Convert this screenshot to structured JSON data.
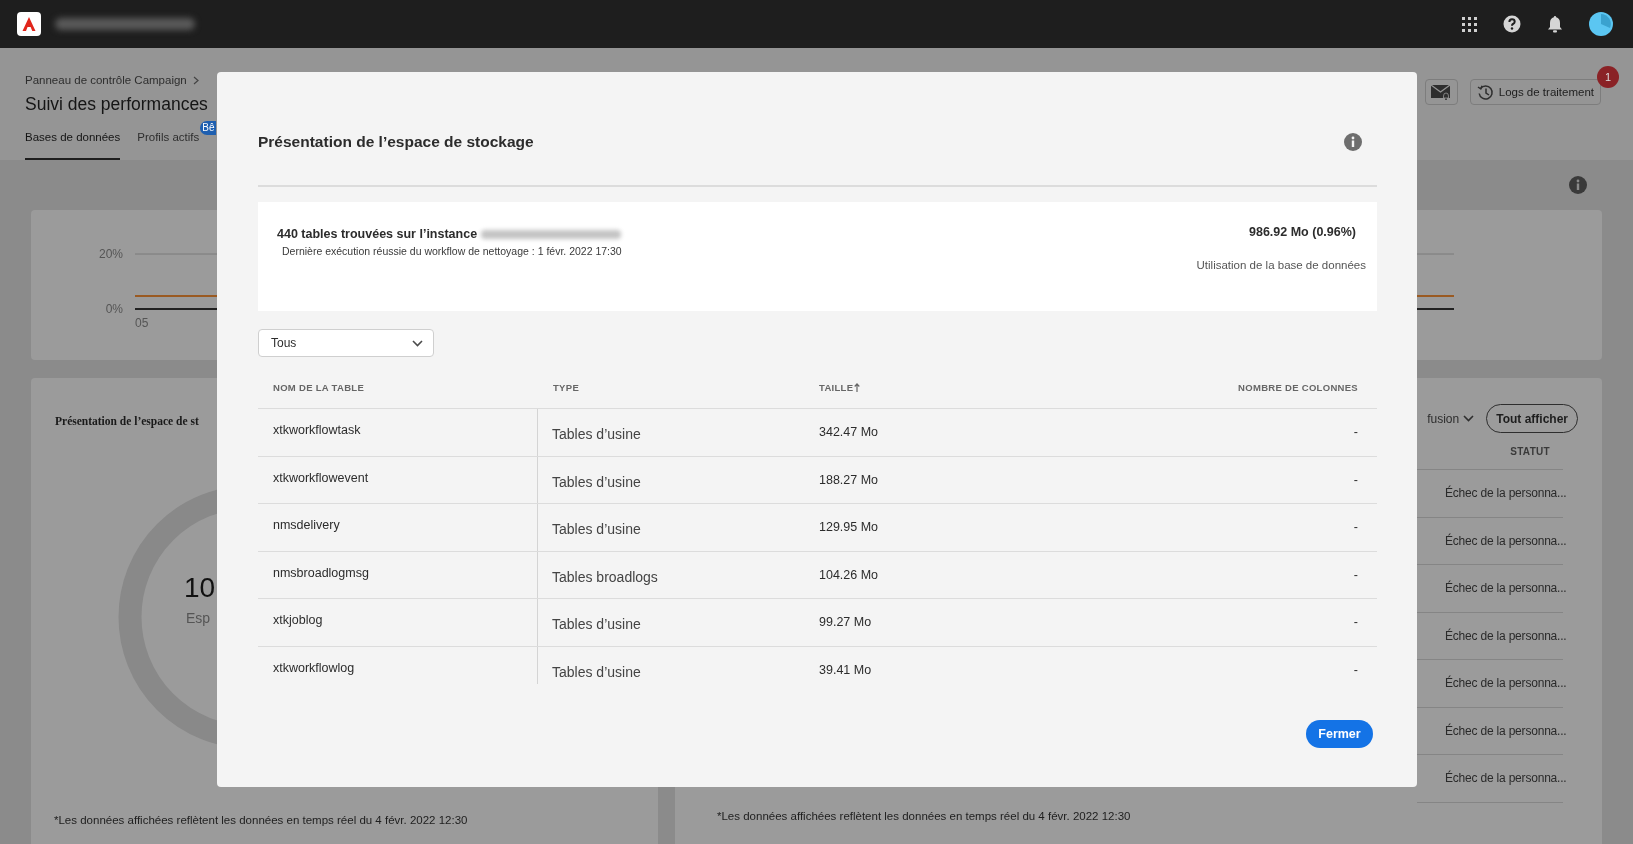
{
  "header": {
    "breadcrumb": "Panneau de contrôle Campaign",
    "title": "Suivi des performances",
    "tabs": [
      {
        "label": "Bases de données",
        "selected": true
      },
      {
        "label": "Profils actifs",
        "selected": false,
        "badge": "Bê"
      }
    ],
    "logs_button": {
      "label": "Logs de traitement",
      "badge": "1"
    }
  },
  "usage_chart": {
    "y_labels": [
      "20%",
      "0%"
    ],
    "x_label": "05"
  },
  "storage_card": {
    "title": "Présentation de l’espace de st",
    "value": "10",
    "caption": "Esp",
    "footnote": "*Les données affichées reflètent les données en temps réel du 4 févr. 2022 12:30"
  },
  "deliveries_card": {
    "filter": "fusion",
    "button": "Tout afficher",
    "status_header": "STATUT",
    "statuses": [
      "Échec de la personna...",
      "Échec de la personna...",
      "Échec de la personna...",
      "Échec de la personna...",
      "Échec de la personna...",
      "Échec de la personna...",
      "Échec de la personna..."
    ],
    "footnote": "*Les données affichées reflètent les données en temps réel du 4 févr. 2022 12:30"
  },
  "modal": {
    "title": "Présentation de l’espace de stockage",
    "summary": {
      "tables_found": "440 tables trouvées sur l’instance",
      "last_cleanup": "Dernière exécution réussie du workflow de nettoyage : 1 févr. 2022 17:30",
      "size": "986.92 Mo (0.96%)",
      "size_label": "Utilisation de la base de données"
    },
    "filter": "Tous",
    "columns": [
      {
        "label": "NOM DE LA TABLE",
        "sorted": false
      },
      {
        "label": "TYPE",
        "sorted": false
      },
      {
        "label": "TAILLE",
        "sorted": true
      },
      {
        "label": "NOMBRE DE COLONNES",
        "sorted": false
      }
    ],
    "rows": [
      {
        "name": "xtkworkflowtask",
        "type": "Tables d’usine",
        "size": "342.47 Mo",
        "columns": "-"
      },
      {
        "name": "xtkworkflowevent",
        "type": "Tables d’usine",
        "size": "188.27 Mo",
        "columns": "-"
      },
      {
        "name": "nmsdelivery",
        "type": "Tables d’usine",
        "size": "129.95 Mo",
        "columns": "-"
      },
      {
        "name": "nmsbroadlogmsg",
        "type": "Tables broadlogs",
        "size": "104.26 Mo",
        "columns": "-"
      },
      {
        "name": "xtkjoblog",
        "type": "Tables d’usine",
        "size": "99.27 Mo",
        "columns": "-"
      },
      {
        "name": "xtkworkflowlog",
        "type": "Tables d’usine",
        "size": "39.41 Mo",
        "columns": "-"
      }
    ],
    "close_button": "Fermer"
  }
}
